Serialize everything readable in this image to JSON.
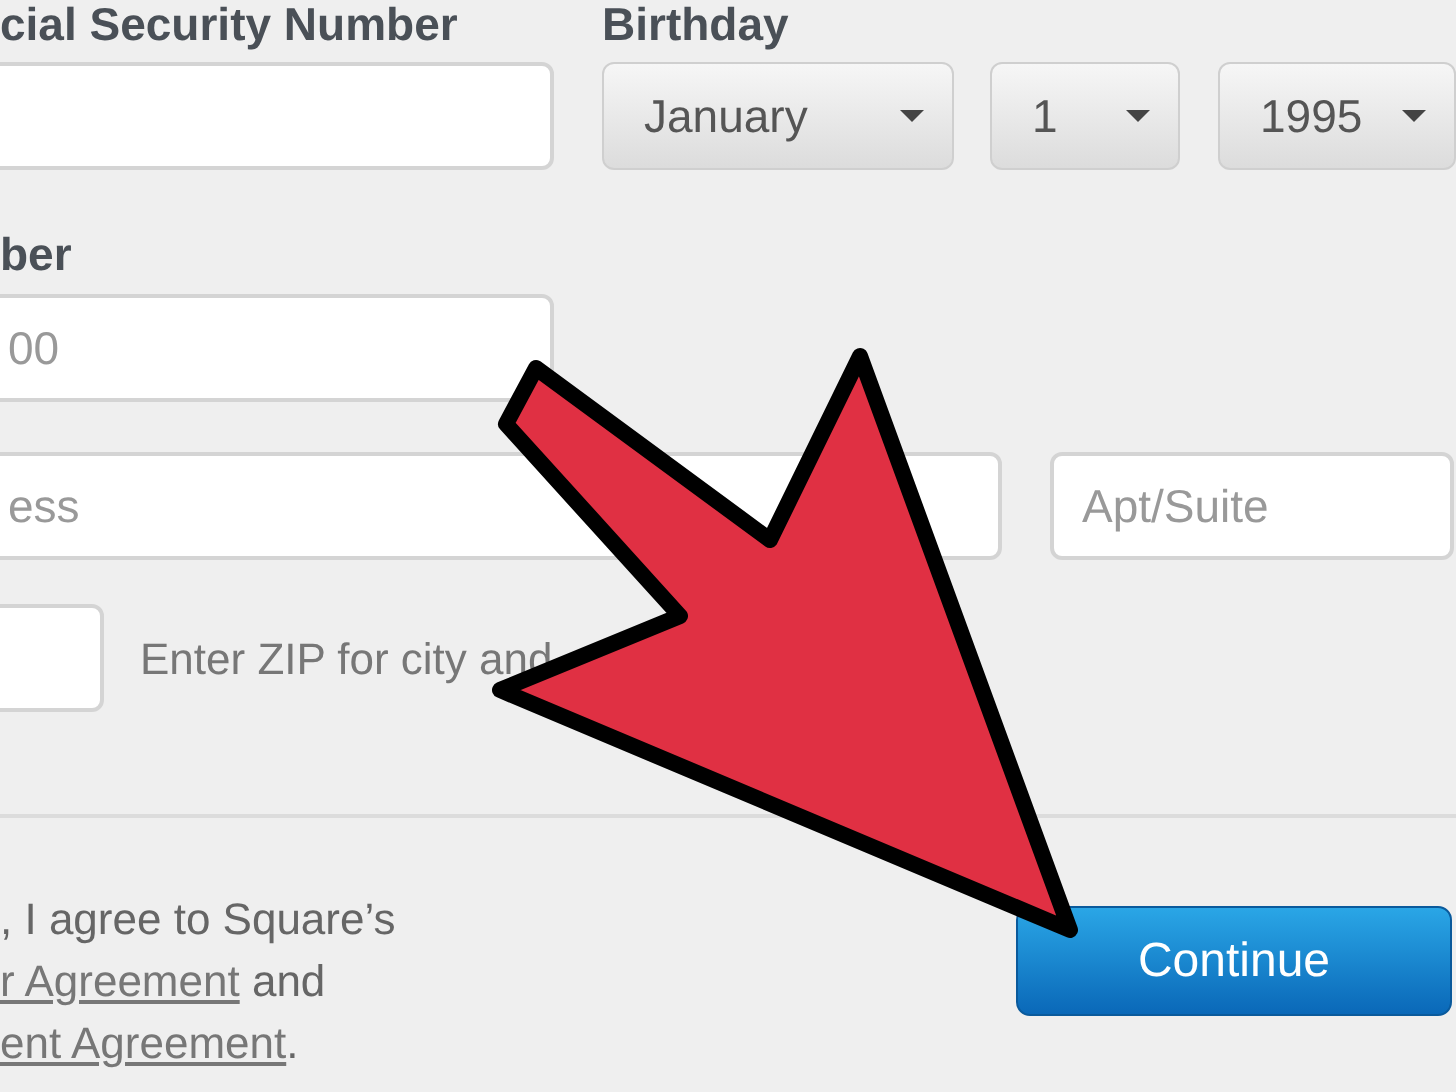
{
  "form": {
    "ssn": {
      "label": "cial Security Number"
    },
    "birthday": {
      "label": "Birthday",
      "selects": [
        {
          "value": "January"
        },
        {
          "value": "1"
        },
        {
          "value": "1995"
        }
      ]
    },
    "phone": {
      "label": "ber",
      "placeholder": "00"
    },
    "address": {
      "placeholder": "ess"
    },
    "apt": {
      "placeholder": "Apt/Suite"
    },
    "zip": {
      "hint": "Enter ZIP for city and"
    }
  },
  "agreement": {
    "intro": ", I agree to Square’s",
    "links": [
      {
        "text": "r Agreement",
        "after": " and"
      },
      {
        "text": "ent Agreement",
        "after": "."
      }
    ]
  },
  "continue_button": "Continue"
}
